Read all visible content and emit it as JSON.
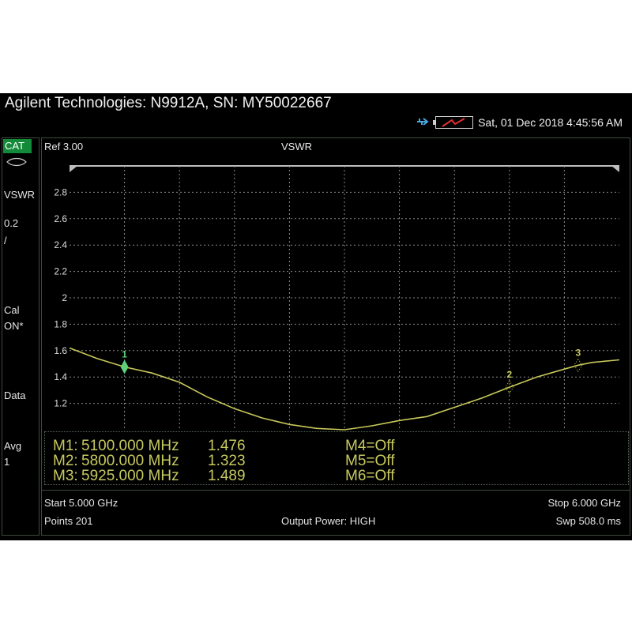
{
  "header": {
    "title": "Agilent Technologies: N9912A, SN: MY50022667",
    "datetime": "Sat, 01 Dec 2018 4:45:56 AM"
  },
  "left_panel": {
    "mode": "CAT",
    "format": "VSWR",
    "scale_line1": "0.2",
    "scale_line2": "/",
    "cal_line1": "Cal",
    "cal_line2": "ON*",
    "data_label": "Data",
    "avg_line1": "Avg",
    "avg_line2": "1"
  },
  "plot": {
    "ref_label": "Ref 3.00",
    "title": "VSWR",
    "y_ticks": [
      "2.8",
      "2.6",
      "2.4",
      "2.2",
      "2",
      "1.8",
      "1.6",
      "1.4",
      "1.2"
    ],
    "trace_color": "#c8c85a",
    "grid_color": "#8a8a8a",
    "marker_color": "#5fd07a"
  },
  "chart_data": {
    "type": "line",
    "x_unit": "GHz",
    "ylim": [
      1.0,
      3.0
    ],
    "xlim": [
      5.0,
      6.0
    ],
    "grid": true,
    "x": [
      5.0,
      5.05,
      5.1,
      5.15,
      5.2,
      5.25,
      5.3,
      5.35,
      5.4,
      5.45,
      5.5,
      5.55,
      5.6,
      5.65,
      5.7,
      5.75,
      5.8,
      5.85,
      5.9,
      5.925,
      5.95,
      6.0
    ],
    "y": [
      1.62,
      1.54,
      1.476,
      1.43,
      1.36,
      1.25,
      1.16,
      1.09,
      1.04,
      1.01,
      1.0,
      1.03,
      1.07,
      1.1,
      1.17,
      1.24,
      1.323,
      1.4,
      1.46,
      1.489,
      1.51,
      1.53
    ],
    "markers": [
      {
        "n": "1",
        "x": 5.1,
        "y": 1.476
      },
      {
        "n": "2",
        "x": 5.8,
        "y": 1.323
      },
      {
        "n": "3",
        "x": 5.925,
        "y": 1.489
      }
    ]
  },
  "markers_table": {
    "m1": {
      "name": "M1:",
      "freq": "5100.000 MHz",
      "value": "1.476"
    },
    "m2": {
      "name": "M2:",
      "freq": "5800.000 MHz",
      "value": "1.323"
    },
    "m3": {
      "name": "M3:",
      "freq": "5925.000 MHz",
      "value": "1.489"
    },
    "m4": "M4=Off",
    "m5": "M5=Off",
    "m6": "M6=Off"
  },
  "footer": {
    "start": "Start 5.000 GHz",
    "stop": "Stop 6.000 GHz",
    "points": "Points 201",
    "output_power": "Output Power: HIGH",
    "sweep": "Swp 508.0 ms"
  }
}
